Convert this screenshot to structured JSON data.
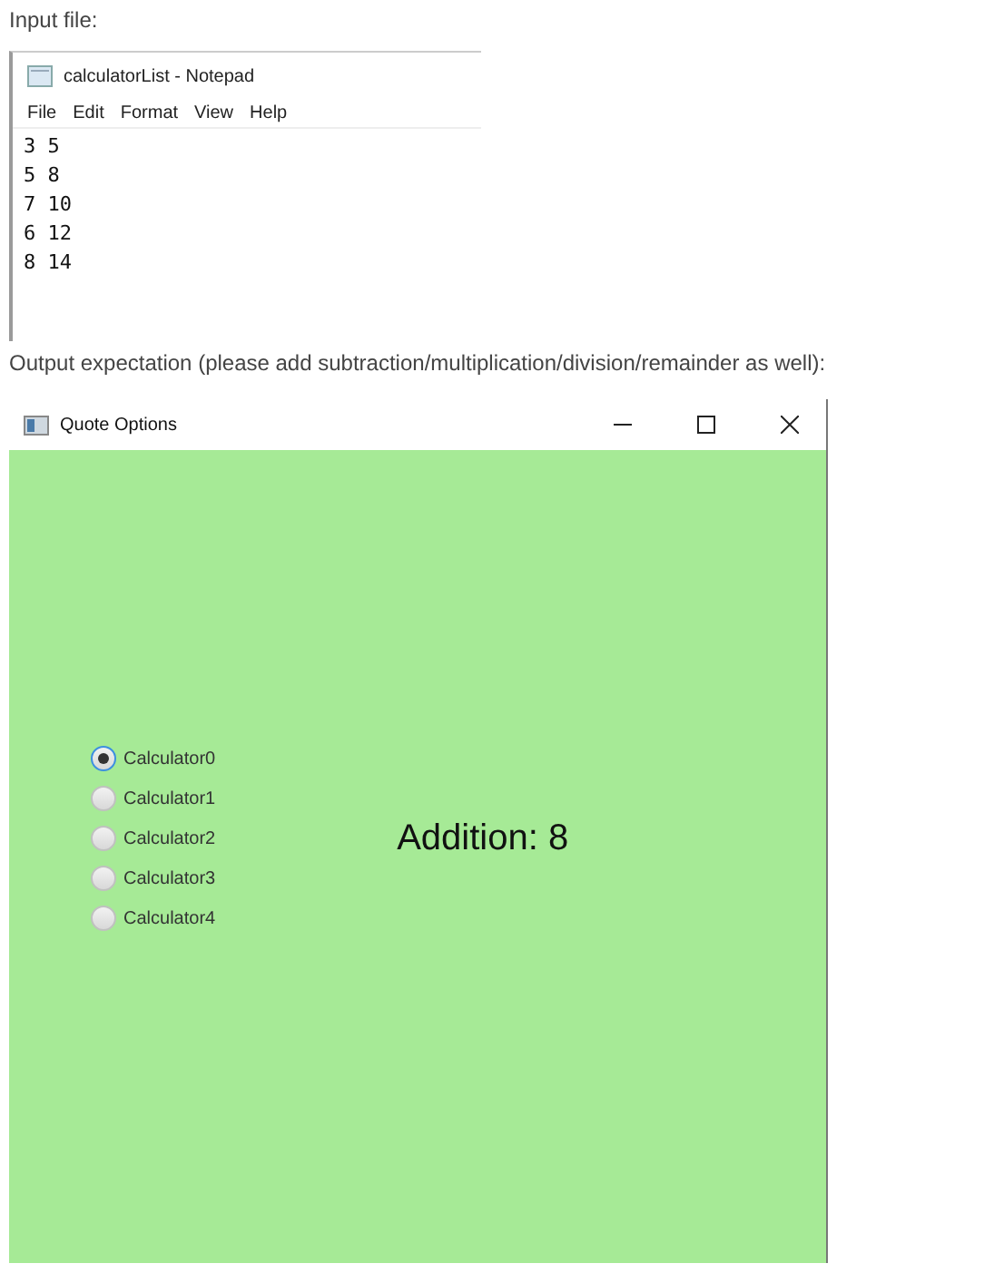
{
  "intro_label": "Input file:",
  "notepad": {
    "title": "calculatorList - Notepad",
    "menu": [
      "File",
      "Edit",
      "Format",
      "View",
      "Help"
    ],
    "lines": [
      "3 5",
      "5 8",
      "7 10",
      "6 12",
      "8 14"
    ]
  },
  "output_label": "Output expectation (please add subtraction/multiplication/division/remainder as well):",
  "app_window": {
    "title": "Quote Options",
    "options": [
      {
        "label": "Calculator0",
        "selected": true
      },
      {
        "label": "Calculator1",
        "selected": false
      },
      {
        "label": "Calculator2",
        "selected": false
      },
      {
        "label": "Calculator3",
        "selected": false
      },
      {
        "label": "Calculator4",
        "selected": false
      }
    ],
    "result": "Addition: 8"
  }
}
